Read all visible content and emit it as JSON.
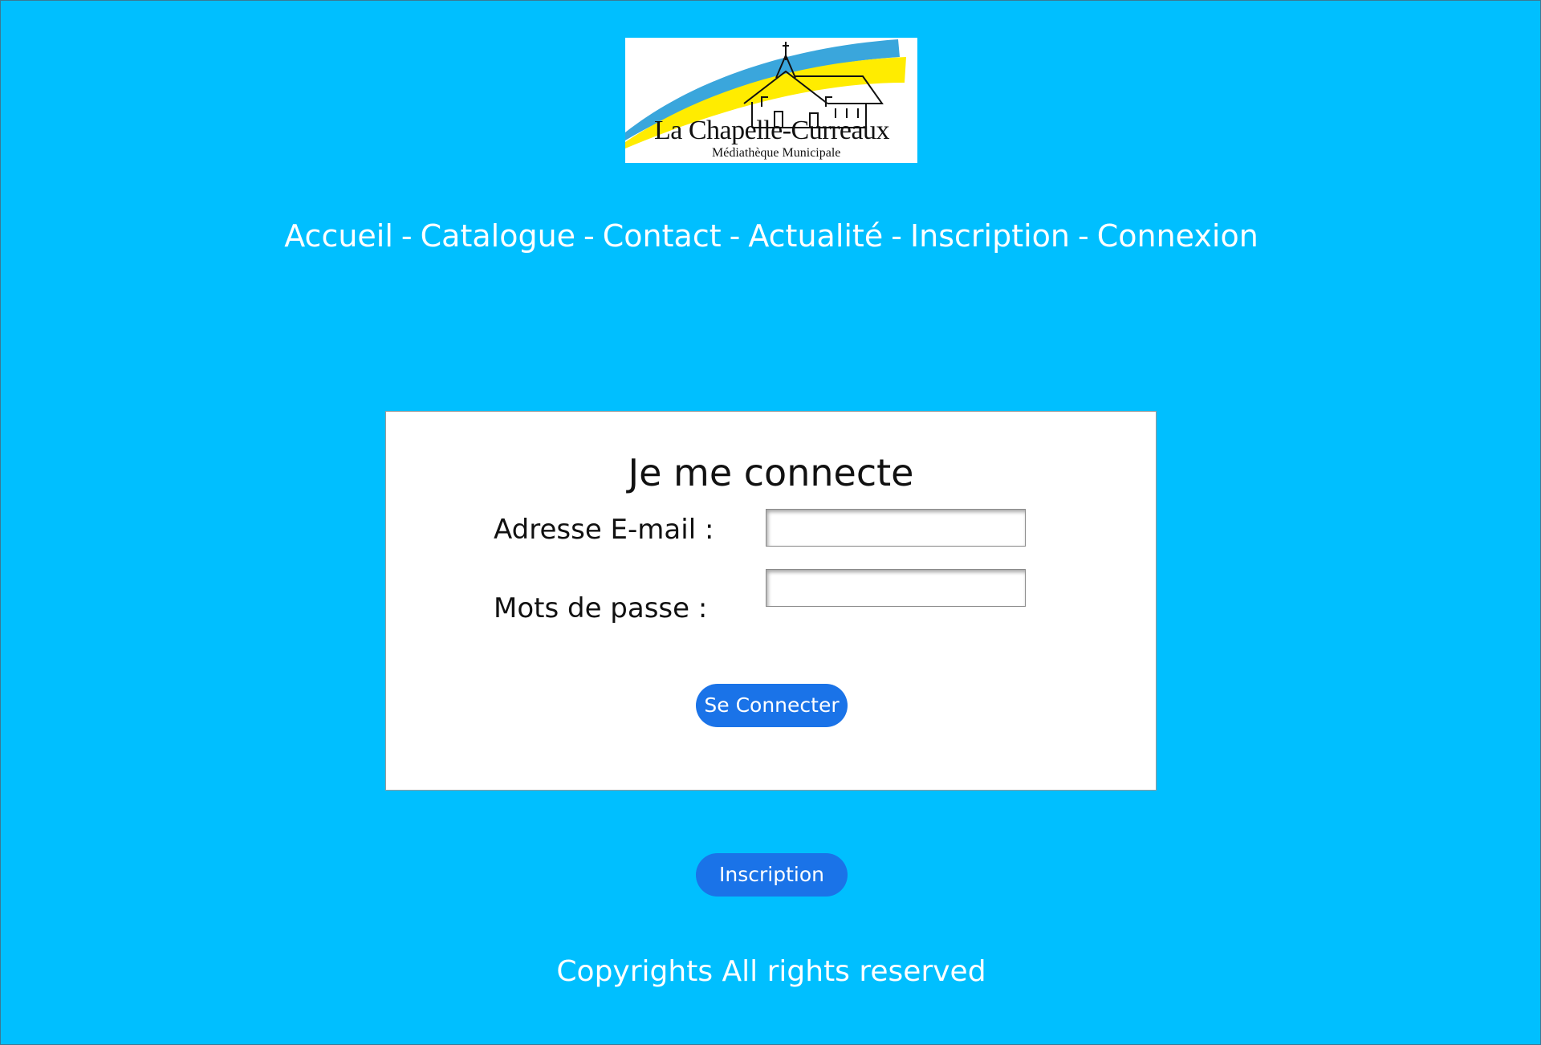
{
  "logo": {
    "title": "La Chapelle-Curreaux",
    "subtitle": "Médiathèque Municipale",
    "colors": {
      "blue": "#3aa6dc",
      "yellow": "#ffec00"
    }
  },
  "nav": {
    "items": [
      "Accueil",
      "Catalogue",
      "Contact",
      "Actualité",
      "Inscription",
      "Connexion"
    ],
    "separator": "-"
  },
  "login": {
    "title": "Je me connecte",
    "email_label": "Adresse E-mail :",
    "email_value": "",
    "password_label": "Mots de passe :",
    "password_value": "",
    "submit_label": "Se Connecter"
  },
  "register_button_label": "Inscription",
  "footer": {
    "text": "Copyrights All rights reserved"
  },
  "colors": {
    "background": "#00bfff",
    "button": "#1a73e8",
    "card": "#ffffff"
  }
}
